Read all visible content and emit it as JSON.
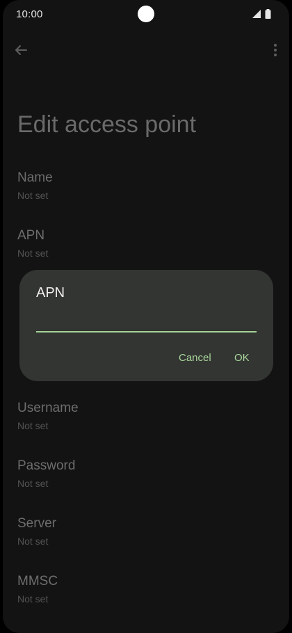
{
  "status_bar": {
    "time": "10:00",
    "icons": [
      "signal-icon",
      "battery-icon"
    ]
  },
  "app_bar": {
    "back_icon": "arrow-back-icon",
    "more_icon": "more-vert-icon"
  },
  "page": {
    "title": "Edit access point",
    "preferences": [
      {
        "label": "Name",
        "value": "Not set"
      },
      {
        "label": "APN",
        "value": "Not set"
      },
      {
        "label": "Username",
        "value": "Not set"
      },
      {
        "label": "Password",
        "value": "Not set"
      },
      {
        "label": "Server",
        "value": "Not set"
      },
      {
        "label": "MMSC",
        "value": "Not set"
      }
    ]
  },
  "dialog": {
    "title": "APN",
    "input_value": "",
    "cancel_label": "Cancel",
    "ok_label": "OK",
    "accent_color": "#a6d39a"
  }
}
